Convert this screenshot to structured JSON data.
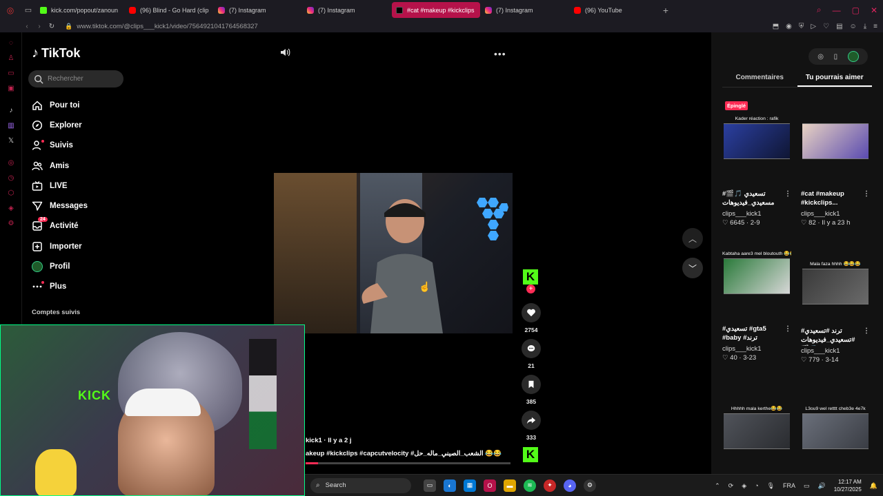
{
  "browser": {
    "tabs": [
      {
        "label": "kick.com/popout/zanoun",
        "favicon": "kick-icon",
        "active": false
      },
      {
        "label": "(96) Blind - Go Hard (clip",
        "favicon": "youtube-icon",
        "active": false
      },
      {
        "label": "(7) Instagram",
        "favicon": "instagram-icon",
        "active": false
      },
      {
        "label": "(7) Instagram",
        "favicon": "instagram-icon",
        "active": false
      },
      {
        "label": "#cat #makeup #kickclips",
        "favicon": "tiktok-icon",
        "active": true
      },
      {
        "label": "(7) Instagram",
        "favicon": "instagram-icon",
        "active": false
      },
      {
        "label": "(96) YouTube",
        "favicon": "youtube-icon",
        "active": false
      }
    ],
    "new_tab_label": "+",
    "url": "www.tiktok.com/@clips___kick1/video/7564921041764568327",
    "accent_color": "#b5124a"
  },
  "tiktok": {
    "logo_text": "TikTok",
    "search_placeholder": "Rechercher",
    "nav": [
      {
        "label": "Pour toi",
        "icon": "home-icon"
      },
      {
        "label": "Explorer",
        "icon": "compass-icon"
      },
      {
        "label": "Suivis",
        "icon": "person-follow-icon",
        "dot": true
      },
      {
        "label": "Amis",
        "icon": "friends-icon"
      },
      {
        "label": "LIVE",
        "icon": "live-tv-icon"
      },
      {
        "label": "Messages",
        "icon": "send-icon"
      },
      {
        "label": "Activité",
        "icon": "inbox-icon",
        "badge": "24"
      },
      {
        "label": "Importer",
        "icon": "upload-plus-icon"
      },
      {
        "label": "Profil",
        "icon": "avatar-icon"
      },
      {
        "label": "Plus",
        "icon": "ellipsis-icon",
        "dot": true
      }
    ],
    "followed_heading": "Comptes suivis",
    "accent_color": "#fe2c55"
  },
  "player": {
    "caption_user": "kick1 · Il y a 2 j",
    "caption_tags": "akeup #kickclips #capcutvelocity #الشعب_الصيني_ماله_حل 😂😂",
    "progress": 0.06,
    "likes": "2754",
    "comments": "21",
    "saves": "385",
    "shares": "333",
    "creator_avatar_letter": "K",
    "follow_plus": "+"
  },
  "side_panel": {
    "tabs": [
      {
        "label": "Commentaires",
        "active": false
      },
      {
        "label": "Tu pourrais aimer",
        "active": true
      }
    ],
    "pinned_label": "Épinglé",
    "recommendations": [
      {
        "thumb_title": "Kader réaction : rafik",
        "desc": "#تسعيدي 🎵🎬 مسعيدي_فيديوهات",
        "author": "clips___kick1",
        "likes": "6645",
        "date": "2-9"
      },
      {
        "thumb_title": "",
        "desc": "#cat #makeup #kickclips...",
        "author": "clips___kick1",
        "likes": "82",
        "date": "Il y a 23 h"
      },
      {
        "thumb_title": "Kabtaha aare3 mel bloutouth 😂😂",
        "desc": "#تسعيدي #gta5 #baby #ترند",
        "author": "clips___kick1",
        "likes": "40",
        "date": "3-23"
      },
      {
        "thumb_title": "Mala faza hhhh 😂😂😂",
        "desc": "#ترند #تسعيدي #تسعيدي_فيديوهات🎬🎵",
        "author": "clips___kick1",
        "likes": "779",
        "date": "3-14"
      },
      {
        "thumb_title": "Hhhhh mala kerthe😂😂",
        "desc": "",
        "author": "",
        "likes": "",
        "date": ""
      },
      {
        "thumb_title": "L3ou9 wel retttt cheb3e 4e7k",
        "desc": "",
        "author": "",
        "likes": "",
        "date": ""
      }
    ]
  },
  "taskbar": {
    "search_placeholder": "Search",
    "lang": "FRA",
    "time": "12:17 AM",
    "date": "10/27/2025"
  }
}
